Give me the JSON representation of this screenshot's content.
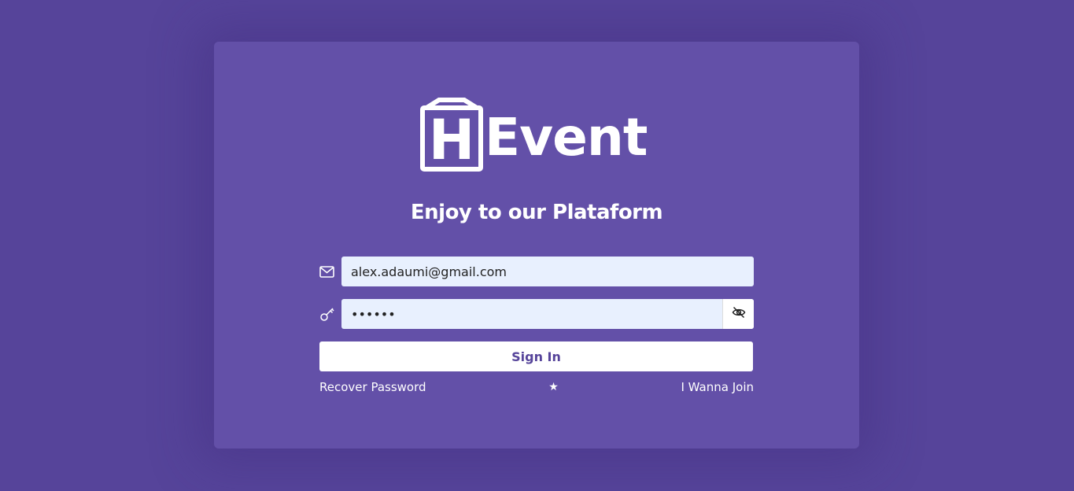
{
  "brand": {
    "logo_letter": "H",
    "logo_text": "Event"
  },
  "heading": "Enjoy to our Plataform",
  "form": {
    "email_value": "alex.adaumi@gmail.com",
    "password_value": "aaaaaa",
    "signin_label": "Sign In"
  },
  "links": {
    "recover": "Recover Password",
    "separator": "★",
    "join": "I Wanna Join"
  },
  "icons": {
    "email": "envelope-icon",
    "password": "key-icon",
    "toggle": "eye-slash-icon"
  },
  "colors": {
    "background": "#56449a",
    "card": "#6350a8",
    "field": "#e8f0fe",
    "accent": "#56449a"
  }
}
